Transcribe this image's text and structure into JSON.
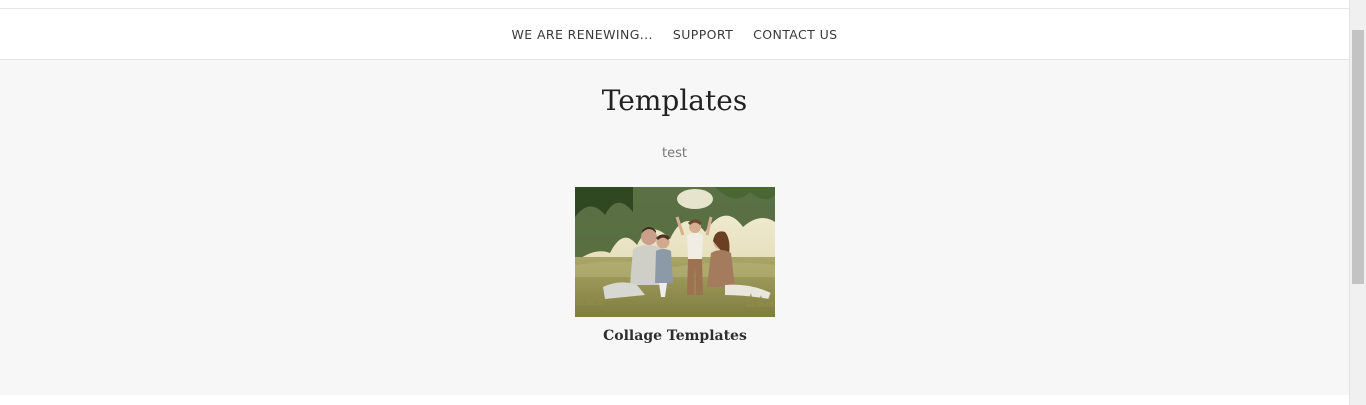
{
  "nav": {
    "items": [
      {
        "label": "WE ARE RENEWING..."
      },
      {
        "label": "SUPPORT"
      },
      {
        "label": "CONTACT US"
      }
    ]
  },
  "main": {
    "title": "Templates",
    "subtitle": "test",
    "cards": [
      {
        "title": "Collage Templates",
        "image": "family-photo-in-meadow"
      }
    ]
  },
  "colors": {
    "nav_text": "#3a3a3a",
    "content_background": "#f7f7f7",
    "title_text": "#222222",
    "subtitle_text": "#777777"
  }
}
